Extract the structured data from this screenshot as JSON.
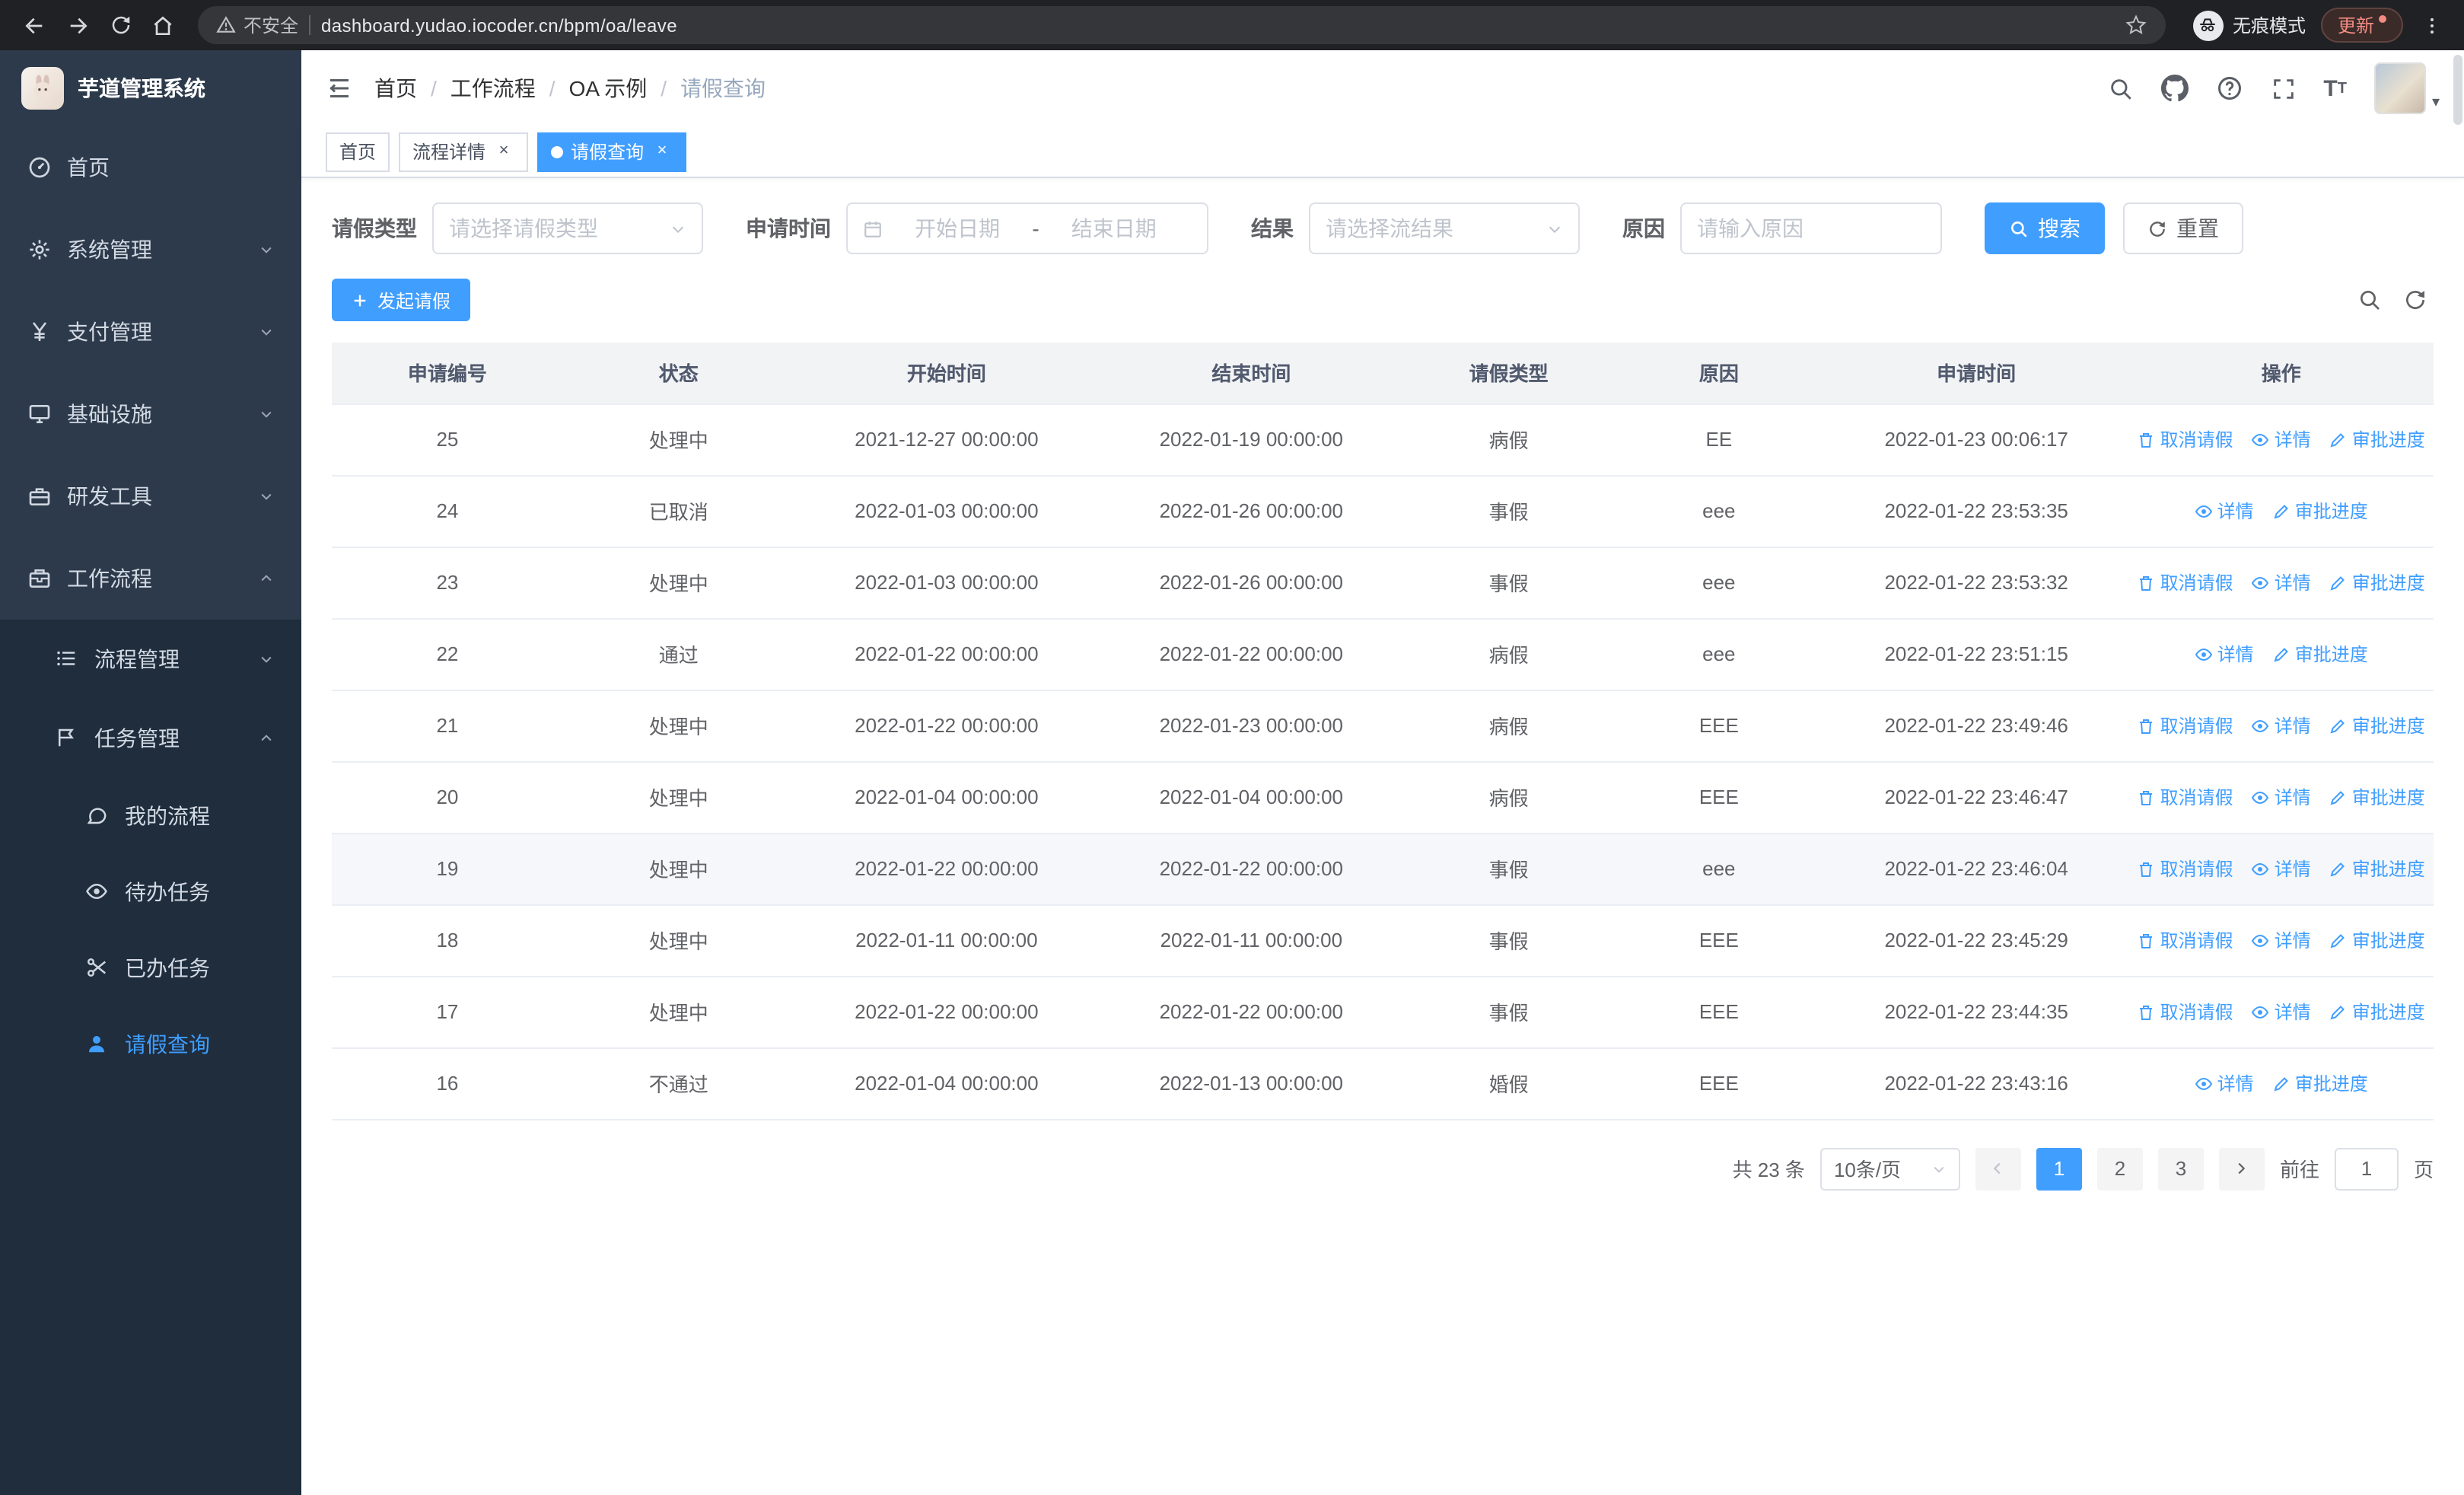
{
  "colors": {
    "accent": "#409eff",
    "sidebar_bg": "#2d3a4b",
    "submenu_bg": "#1f2d3d"
  },
  "browser": {
    "security_label": "不安全",
    "url": "dashboard.yudao.iocoder.cn/bpm/oa/leave",
    "incognito_label": "无痕模式",
    "update_label": "更新"
  },
  "sidebar": {
    "title": "芋道管理系统",
    "items": {
      "home": "首页",
      "system": "系统管理",
      "pay": "支付管理",
      "infra": "基础设施",
      "dev": "研发工具",
      "workflow": "工作流程",
      "process": "流程管理",
      "task": "任务管理",
      "my_process": "我的流程",
      "todo": "待办任务",
      "done": "已办任务",
      "leave": "请假查询"
    }
  },
  "header": {
    "breadcrumb": [
      "首页",
      "工作流程",
      "OA 示例",
      "请假查询"
    ]
  },
  "tabs": {
    "home": "首页",
    "detail": "流程详情",
    "leave": "请假查询"
  },
  "filters": {
    "leave_type_label": "请假类型",
    "leave_type_placeholder": "请选择请假类型",
    "time_label": "申请时间",
    "start_placeholder": "开始日期",
    "range_separator": "-",
    "end_placeholder": "结束日期",
    "result_label": "结果",
    "result_placeholder": "请选择流结果",
    "reason_label": "原因",
    "reason_placeholder": "请输入原因",
    "search_label": "搜索",
    "reset_label": "重置"
  },
  "toolbar": {
    "create_label": "发起请假"
  },
  "table": {
    "columns": [
      "申请编号",
      "状态",
      "开始时间",
      "结束时间",
      "请假类型",
      "原因",
      "申请时间",
      "操作"
    ],
    "actions": {
      "cancel": "取消请假",
      "detail": "详情",
      "progress": "审批进度"
    },
    "rows": [
      {
        "id": "25",
        "status": "处理中",
        "start": "2021-12-27 00:00:00",
        "end": "2022-01-19 00:00:00",
        "type": "病假",
        "reason": "EE",
        "applied": "2022-01-23 00:06:17"
      },
      {
        "id": "24",
        "status": "已取消",
        "start": "2022-01-03 00:00:00",
        "end": "2022-01-26 00:00:00",
        "type": "事假",
        "reason": "eee",
        "applied": "2022-01-22 23:53:35"
      },
      {
        "id": "23",
        "status": "处理中",
        "start": "2022-01-03 00:00:00",
        "end": "2022-01-26 00:00:00",
        "type": "事假",
        "reason": "eee",
        "applied": "2022-01-22 23:53:32"
      },
      {
        "id": "22",
        "status": "通过",
        "start": "2022-01-22 00:00:00",
        "end": "2022-01-22 00:00:00",
        "type": "病假",
        "reason": "eee",
        "applied": "2022-01-22 23:51:15"
      },
      {
        "id": "21",
        "status": "处理中",
        "start": "2022-01-22 00:00:00",
        "end": "2022-01-23 00:00:00",
        "type": "病假",
        "reason": "EEE",
        "applied": "2022-01-22 23:49:46"
      },
      {
        "id": "20",
        "status": "处理中",
        "start": "2022-01-04 00:00:00",
        "end": "2022-01-04 00:00:00",
        "type": "病假",
        "reason": "EEE",
        "applied": "2022-01-22 23:46:47"
      },
      {
        "id": "19",
        "status": "处理中",
        "start": "2022-01-22 00:00:00",
        "end": "2022-01-22 00:00:00",
        "type": "事假",
        "reason": "eee",
        "applied": "2022-01-22 23:46:04"
      },
      {
        "id": "18",
        "status": "处理中",
        "start": "2022-01-11 00:00:00",
        "end": "2022-01-11 00:00:00",
        "type": "事假",
        "reason": "EEE",
        "applied": "2022-01-22 23:45:29"
      },
      {
        "id": "17",
        "status": "处理中",
        "start": "2022-01-22 00:00:00",
        "end": "2022-01-22 00:00:00",
        "type": "事假",
        "reason": "EEE",
        "applied": "2022-01-22 23:44:35"
      },
      {
        "id": "16",
        "status": "不通过",
        "start": "2022-01-04 00:00:00",
        "end": "2022-01-13 00:00:00",
        "type": "婚假",
        "reason": "EEE",
        "applied": "2022-01-22 23:43:16"
      }
    ]
  },
  "pagination": {
    "total": "共 23 条",
    "size": "10条/页",
    "page1": "1",
    "page2": "2",
    "page3": "3",
    "goto_label": "前往",
    "goto_value": "1",
    "unit_label": "页"
  }
}
